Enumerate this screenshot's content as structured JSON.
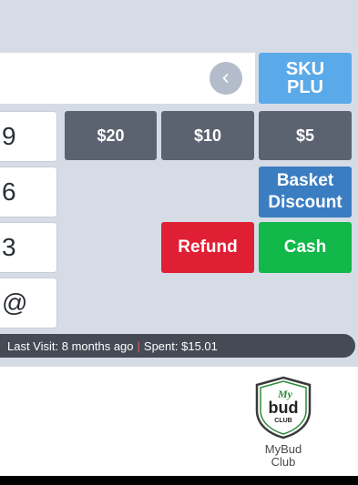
{
  "sku_button": {
    "line1": "SKU",
    "line2": "PLU"
  },
  "cash_buttons": [
    "$20",
    "$10",
    "$5"
  ],
  "basket_discount": {
    "line1": "Basket",
    "line2": "Discount"
  },
  "refund_label": "Refund",
  "cash_label": "Cash",
  "keypad": [
    "9",
    "6",
    "3",
    "@"
  ],
  "status": {
    "last_visit": "Last Visit: 8 months ago",
    "separator": "|",
    "spent": "Spent: $15.01"
  },
  "logo_text": {
    "line1": "My",
    "line2": "bud",
    "line3": "CLUB"
  },
  "logo_caption": {
    "line1": "MyBud",
    "line2": "Club"
  },
  "icons": {
    "back": "chevron-left-icon",
    "logo": "mybud-club-shield-logo"
  },
  "colors": {
    "panel": "#d6dce6",
    "sku": "#5aa9e8",
    "gray": "#5b6371",
    "basket": "#3b7dc1",
    "refund": "#e01f35",
    "cash": "#12b84a",
    "status_bar": "#454b55"
  }
}
